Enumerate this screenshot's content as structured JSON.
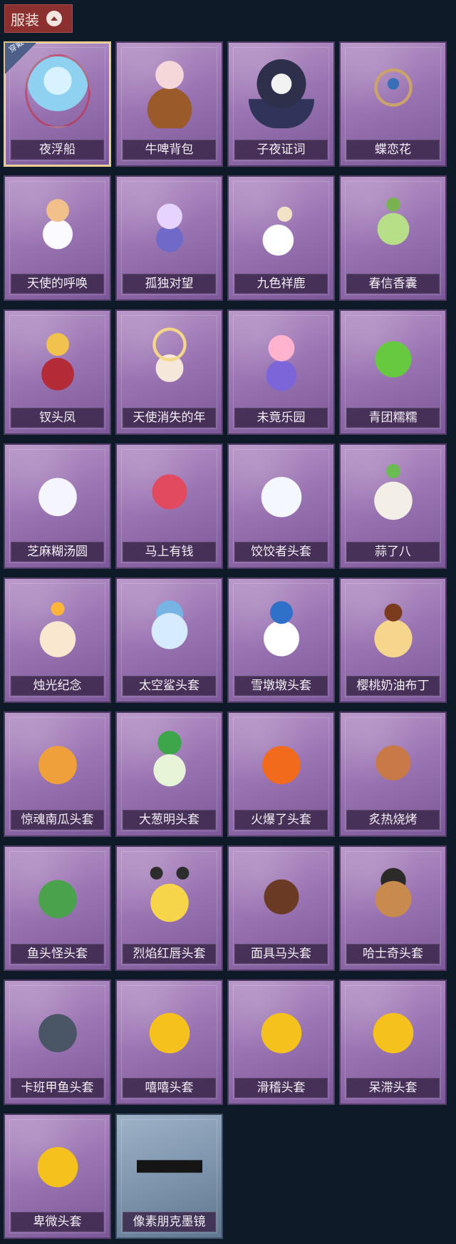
{
  "header": {
    "label": "服装"
  },
  "items": [
    {
      "label": "夜浮船",
      "badge": "穿戴",
      "art": "ice",
      "selected": true
    },
    {
      "label": "牛啤背包",
      "art": "cow"
    },
    {
      "label": "子夜证词",
      "art": "owl"
    },
    {
      "label": "蝶恋花",
      "art": "flower"
    },
    {
      "label": "天使的呼唤",
      "art": "angel"
    },
    {
      "label": "孤独对望",
      "art": "doll"
    },
    {
      "label": "九色祥鹿",
      "art": "deer"
    },
    {
      "label": "春信香囊",
      "art": "bag"
    },
    {
      "label": "钗头凤",
      "art": "crown"
    },
    {
      "label": "天使消失的年",
      "art": "halo"
    },
    {
      "label": "未竟乐园",
      "art": "pink"
    },
    {
      "label": "青团糯糯",
      "art": "green"
    },
    {
      "label": "芝麻糊汤圆",
      "art": "white"
    },
    {
      "label": "马上有钱",
      "art": "redhorse"
    },
    {
      "label": "饺饺者头套",
      "art": "cloud"
    },
    {
      "label": "蒜了八",
      "art": "garlic"
    },
    {
      "label": "烛光纪念",
      "art": "candle"
    },
    {
      "label": "太空鲨头套",
      "art": "shark"
    },
    {
      "label": "雪墩墩头套",
      "art": "snow"
    },
    {
      "label": "樱桃奶油布丁",
      "art": "pudding"
    },
    {
      "label": "惊魂南瓜头套",
      "art": "pumpkin"
    },
    {
      "label": "大葱明头套",
      "art": "leek"
    },
    {
      "label": "火爆了头套",
      "art": "fire"
    },
    {
      "label": "炙热烧烤",
      "art": "meat"
    },
    {
      "label": "鱼头怪头套",
      "art": "fish"
    },
    {
      "label": "烈焰红唇头套",
      "art": "pika"
    },
    {
      "label": "面具马头套",
      "art": "horse"
    },
    {
      "label": "哈士奇头套",
      "art": "dog"
    },
    {
      "label": "卡班甲鱼头套",
      "art": "whale"
    },
    {
      "label": "嘻嘻头套",
      "art": "emoji"
    },
    {
      "label": "滑稽头套",
      "art": "emoji"
    },
    {
      "label": "呆滞头套",
      "art": "emoji"
    },
    {
      "label": "卑微头套",
      "art": "emoji"
    },
    {
      "label": "像素朋克墨镜",
      "art": "glasses",
      "variant": "blue"
    }
  ]
}
